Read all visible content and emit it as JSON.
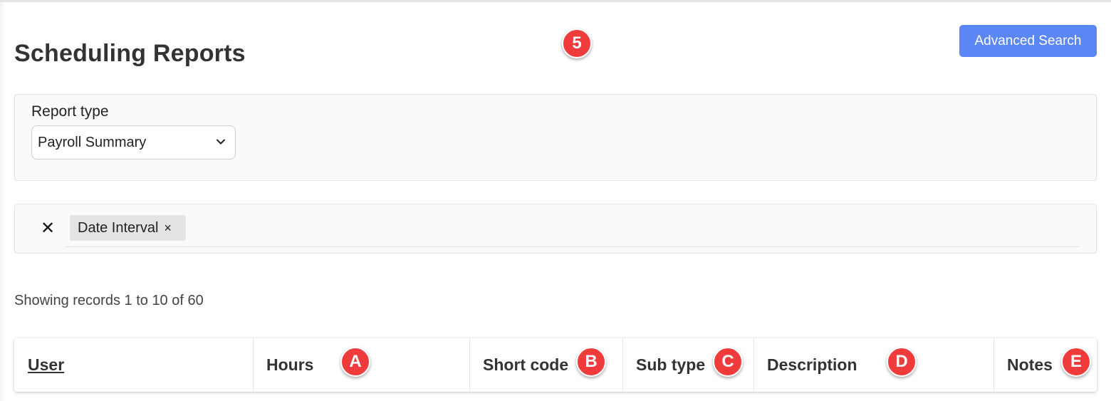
{
  "page": {
    "title": "Scheduling Reports",
    "advanced_search_label": "Advanced Search"
  },
  "report_type": {
    "label": "Report type",
    "selected": "Payroll Summary"
  },
  "filters": {
    "tags": [
      {
        "label": "Date Interval",
        "remove_label": "×"
      }
    ],
    "clear_all_label": "✕"
  },
  "records_summary": "Showing records 1 to 10 of 60",
  "table": {
    "columns": [
      {
        "label": "User"
      },
      {
        "label": "Hours"
      },
      {
        "label": "Short code"
      },
      {
        "label": "Sub type"
      },
      {
        "label": "Description"
      },
      {
        "label": "Notes"
      }
    ]
  },
  "markers": [
    "5",
    "A",
    "B",
    "C",
    "D",
    "E"
  ],
  "colors": {
    "primary_button": "#5b86f5",
    "marker": "#ef3b3b",
    "panel_bg": "#fafafa",
    "tag_bg": "#e4e4e4"
  },
  "icons": {
    "select_caret": "chevron-down-icon",
    "clear_filters": "close-icon",
    "remove_tag": "close-icon"
  }
}
